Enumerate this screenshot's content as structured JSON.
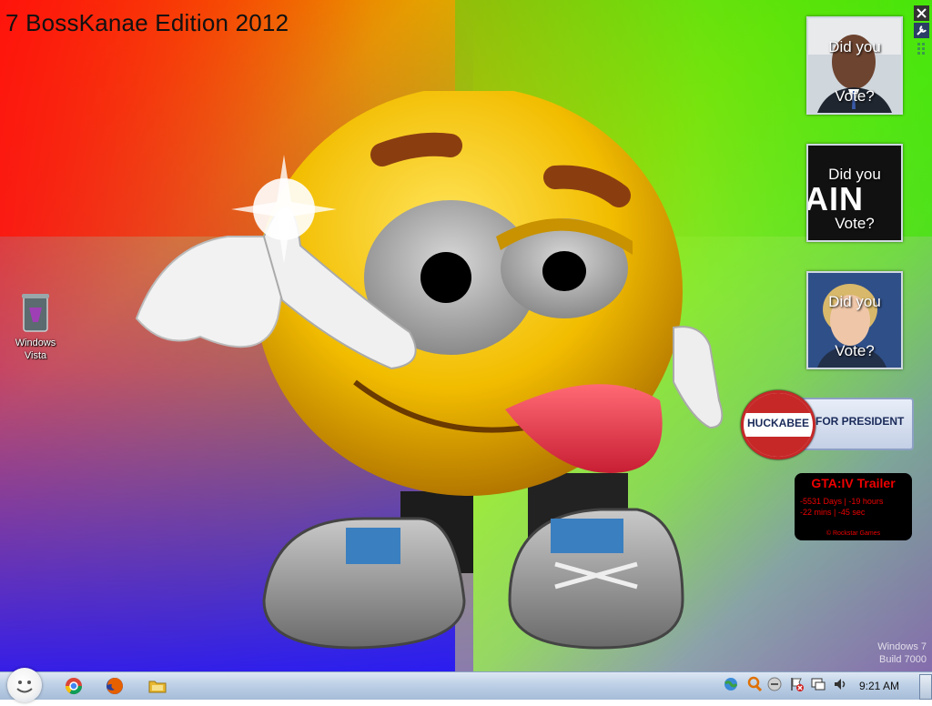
{
  "desktop": {
    "edition_title": "7 BossKanae Edition 2012",
    "watermark_line1": "Windows 7",
    "watermark_line2": "Build 7000"
  },
  "icons": {
    "recycle_bin_label_line1": "Windows",
    "recycle_bin_label_line2": "Vista"
  },
  "gadgets": {
    "vote1": {
      "line1": "Did you",
      "line2": "Vote?"
    },
    "vote2": {
      "line1": "Did you",
      "line2": "Vote?",
      "banner_text": "AIN"
    },
    "vote3": {
      "line1": "Did you",
      "line2": "Vote?"
    },
    "huckabee": {
      "name": "HUCKABEE",
      "slogan": "FOR PRESIDENT"
    },
    "gta": {
      "title": "GTA:IV  Trailer",
      "countdown_line1": "-5531 Days | -19 hours",
      "countdown_line2": "-22 mins | -45 sec",
      "credit": "© Rockstar Games"
    }
  },
  "taskbar": {
    "clock": "9:21 AM",
    "apps": [
      "chrome-icon",
      "firefox-icon",
      "folder-icon"
    ],
    "tray": [
      "network-globe-icon",
      "search-icon",
      "messenger-icon",
      "action-center-icon",
      "display-icon",
      "volume-icon"
    ]
  },
  "colors": {
    "taskbar_top": "#dde7f3",
    "taskbar_bottom": "#a6bcd8",
    "gta_red": "#ee0000",
    "smiley_yellow": "#f5c400"
  }
}
